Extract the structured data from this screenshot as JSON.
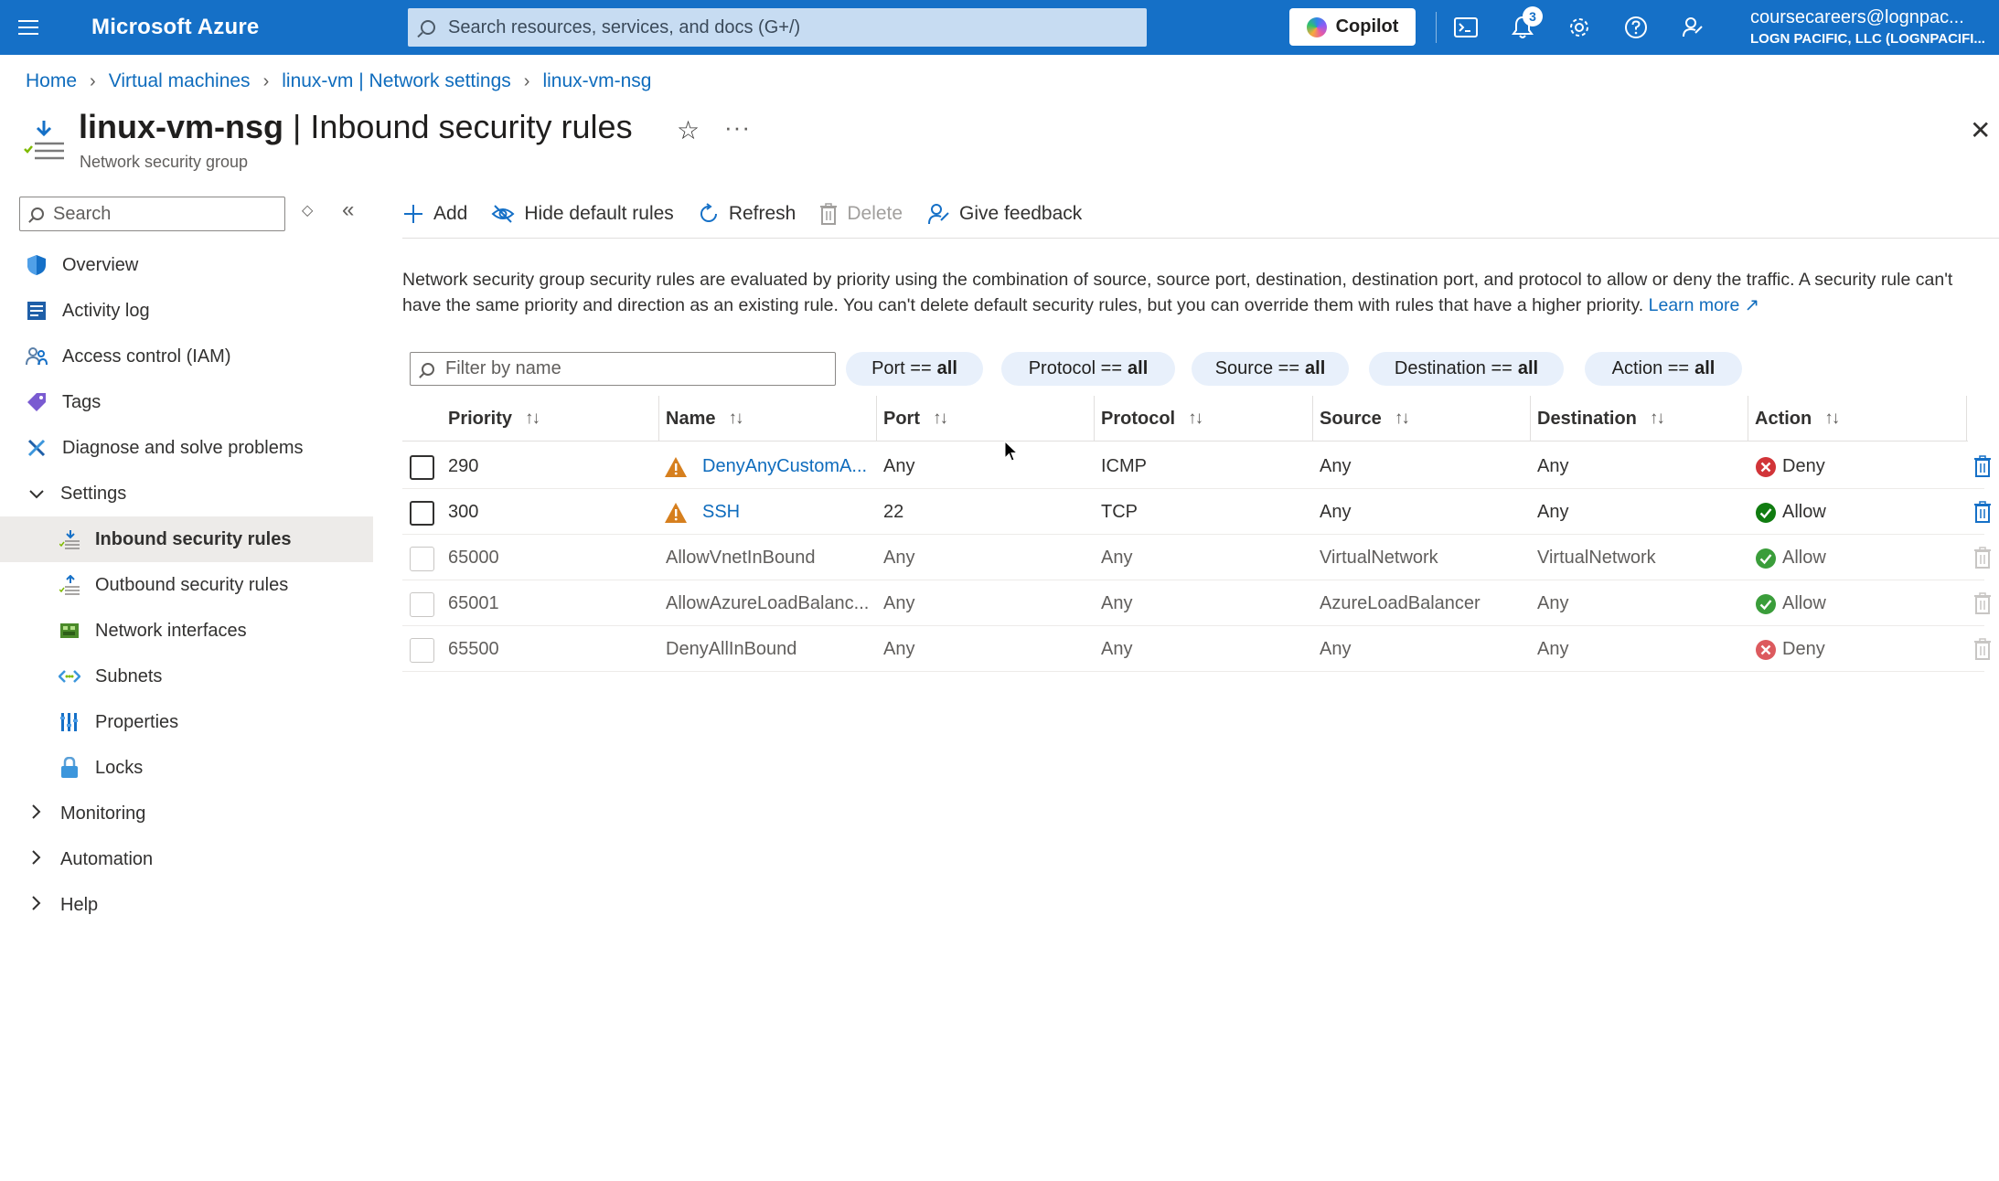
{
  "topbar": {
    "brand": "Microsoft Azure",
    "search_placeholder": "Search resources, services, and docs (G+/)",
    "copilot_label": "Copilot",
    "notification_count": "3",
    "account_email": "coursecareers@lognpac...",
    "account_tenant": "LOGN PACIFIC, LLC (LOGNPACIFI..."
  },
  "breadcrumb": [
    "Home",
    "Virtual machines",
    "linux-vm | Network settings",
    "linux-vm-nsg"
  ],
  "header": {
    "resource_name": "linux-vm-nsg",
    "blade_title": " | Inbound security rules",
    "subtitle": "Network security group"
  },
  "sidebar": {
    "search_placeholder": "Search",
    "items": [
      {
        "label": "Overview"
      },
      {
        "label": "Activity log"
      },
      {
        "label": "Access control (IAM)"
      },
      {
        "label": "Tags"
      },
      {
        "label": "Diagnose and solve problems"
      },
      {
        "label": "Settings"
      },
      {
        "label": "Inbound security rules"
      },
      {
        "label": "Outbound security rules"
      },
      {
        "label": "Network interfaces"
      },
      {
        "label": "Subnets"
      },
      {
        "label": "Properties"
      },
      {
        "label": "Locks"
      },
      {
        "label": "Monitoring"
      },
      {
        "label": "Automation"
      },
      {
        "label": "Help"
      }
    ]
  },
  "toolbar": {
    "add": "Add",
    "hide_default": "Hide default rules",
    "refresh": "Refresh",
    "delete": "Delete",
    "feedback": "Give feedback"
  },
  "description": {
    "text": "Network security group security rules are evaluated by priority using the combination of source, source port, destination, destination port, and protocol to allow or deny the traffic. A security rule can't have the same priority and direction as an existing rule. You can't delete default security rules, but you can override them with rules that have a higher priority. ",
    "learn_more": "Learn more"
  },
  "filters": {
    "name_placeholder": "Filter by name",
    "pills": [
      {
        "key": "Port ==",
        "value": "all"
      },
      {
        "key": "Protocol ==",
        "value": "all"
      },
      {
        "key": "Source ==",
        "value": "all"
      },
      {
        "key": "Destination ==",
        "value": "all"
      },
      {
        "key": "Action ==",
        "value": "all"
      }
    ]
  },
  "table": {
    "columns": [
      "Priority",
      "Name",
      "Port",
      "Protocol",
      "Source",
      "Destination",
      "Action"
    ],
    "rows": [
      {
        "priority": "290",
        "name": "DenyAnyCustomA...",
        "port": "Any",
        "protocol": "ICMP",
        "source": "Any",
        "destination": "Any",
        "action": "Deny"
      },
      {
        "priority": "300",
        "name": "SSH",
        "port": "22",
        "protocol": "TCP",
        "source": "Any",
        "destination": "Any",
        "action": "Allow"
      },
      {
        "priority": "65000",
        "name": "AllowVnetInBound",
        "port": "Any",
        "protocol": "Any",
        "source": "VirtualNetwork",
        "destination": "VirtualNetwork",
        "action": "Allow"
      },
      {
        "priority": "65001",
        "name": "AllowAzureLoadBalanc...",
        "port": "Any",
        "protocol": "Any",
        "source": "AzureLoadBalancer",
        "destination": "Any",
        "action": "Allow"
      },
      {
        "priority": "65500",
        "name": "DenyAllInBound",
        "port": "Any",
        "protocol": "Any",
        "source": "Any",
        "destination": "Any",
        "action": "Deny"
      }
    ]
  },
  "colors": {
    "azure_blue": "#1570c7",
    "link": "#0f6cbd",
    "deny_red": "#d13438",
    "allow_green": "#107c10",
    "warning_orange": "#d67f1e"
  }
}
